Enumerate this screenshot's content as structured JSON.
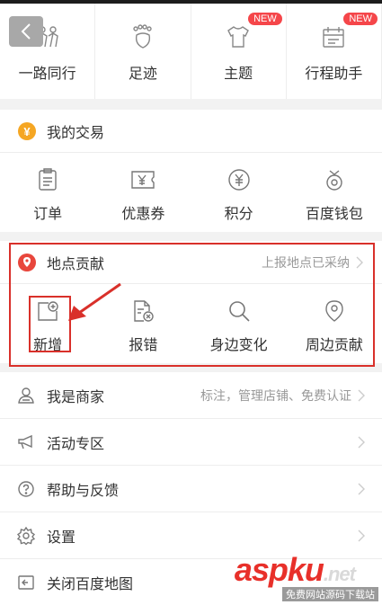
{
  "top_grid": [
    {
      "label": "一路同行",
      "icon": "people-icon",
      "badge": ""
    },
    {
      "label": "足迹",
      "icon": "footprint-icon",
      "badge": ""
    },
    {
      "label": "主题",
      "icon": "tshirt-icon",
      "badge": "NEW"
    },
    {
      "label": "行程助手",
      "icon": "calendar-icon",
      "badge": "NEW"
    }
  ],
  "trade": {
    "title": "我的交易",
    "icon": "yuan-circle-icon",
    "items": [
      {
        "label": "订单",
        "icon": "order-icon"
      },
      {
        "label": "优惠券",
        "icon": "coupon-icon"
      },
      {
        "label": "积分",
        "icon": "points-icon"
      },
      {
        "label": "百度钱包",
        "icon": "wallet-icon"
      }
    ]
  },
  "place": {
    "title": "地点贡献",
    "subtitle": "上报地点已采纳",
    "icon": "location-pin-icon",
    "items": [
      {
        "label": "新增",
        "icon": "add-place-icon"
      },
      {
        "label": "报错",
        "icon": "report-error-icon"
      },
      {
        "label": "身边变化",
        "icon": "search-icon"
      },
      {
        "label": "周边贡献",
        "icon": "pin-outline-icon"
      }
    ]
  },
  "list": [
    {
      "label": "我是商家",
      "subtitle": "标注，管理店铺、免费认证",
      "icon": "merchant-icon"
    },
    {
      "label": "活动专区",
      "subtitle": "",
      "icon": "megaphone-icon"
    },
    {
      "label": "帮助与反馈",
      "subtitle": "",
      "icon": "help-icon"
    },
    {
      "label": "设置",
      "subtitle": "",
      "icon": "gear-icon"
    },
    {
      "label": "关闭百度地图",
      "subtitle": "",
      "icon": "exit-icon"
    }
  ],
  "watermark": {
    "logo": "aspku",
    "suffix": ".net",
    "tagline": "免费网站源码下载站"
  },
  "colors": {
    "accent_red": "#d9302a",
    "badge_red": "#f5464a",
    "yuan_orange": "#f5a623",
    "pin_red": "#e8463c"
  }
}
